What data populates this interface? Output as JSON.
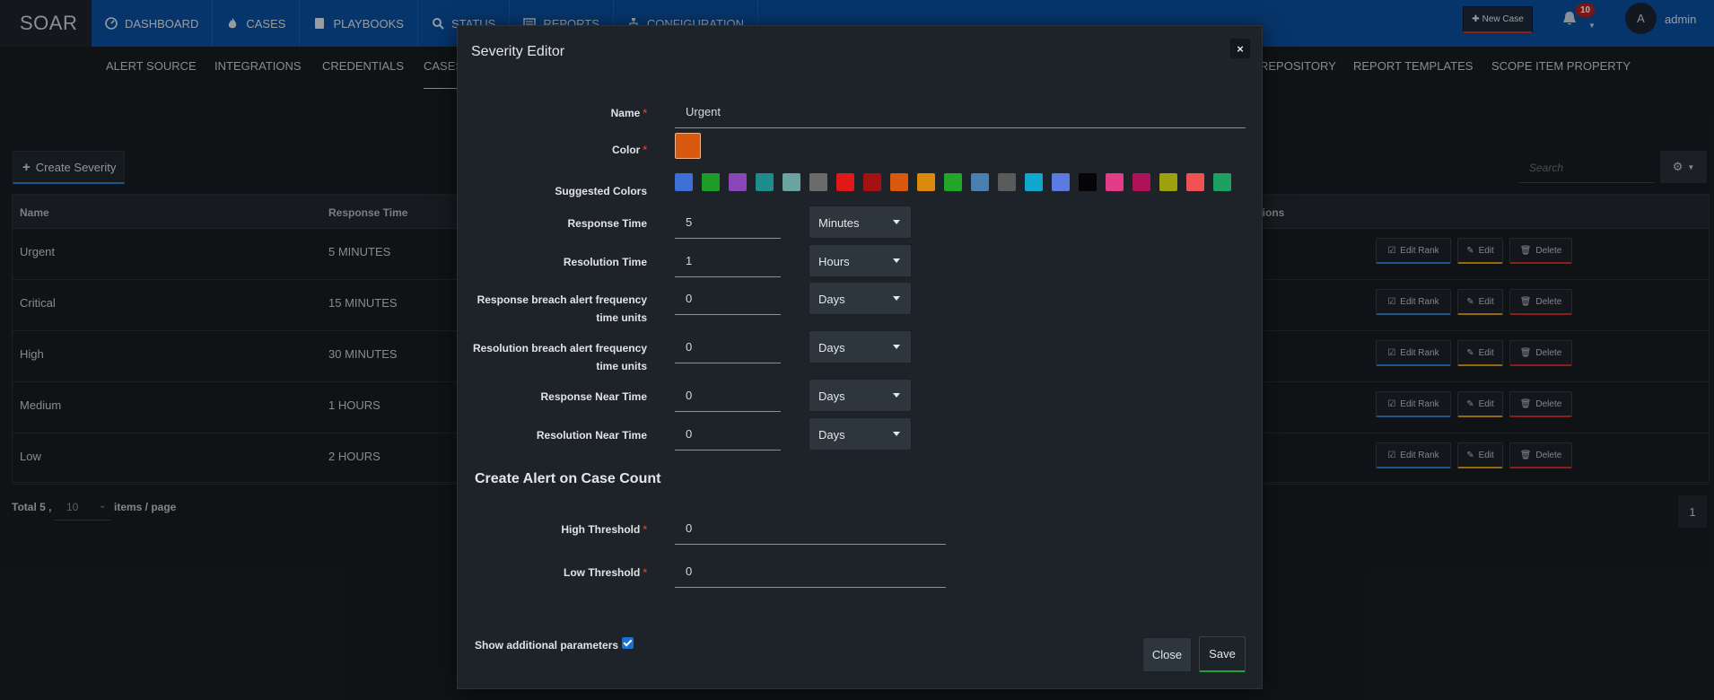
{
  "app": {
    "brand": "SOAR"
  },
  "nav": [
    {
      "label": "DASHBOARD",
      "icon": "dashboard-icon"
    },
    {
      "label": "CASES",
      "icon": "fire-icon"
    },
    {
      "label": "PLAYBOOKS",
      "icon": "book-icon"
    },
    {
      "label": "STATUS",
      "icon": "search-icon"
    },
    {
      "label": "REPORTS",
      "icon": "report-icon"
    },
    {
      "label": "CONFIGURATION",
      "icon": "sitemap-icon"
    }
  ],
  "header": {
    "new_case": "New Case",
    "notifications": "10",
    "avatar_letter": "A",
    "username": "admin"
  },
  "subnav": {
    "items": [
      "ALERT SOURCE",
      "INTEGRATIONS",
      "CREDENTIALS",
      "CASES",
      "REPOSITORY",
      "REPORT TEMPLATES",
      "SCOPE ITEM PROPERTY"
    ]
  },
  "page": {
    "create_button": "Create Severity",
    "search_placeholder": "Search",
    "columns": {
      "name": "Name",
      "response_time": "Response Time",
      "actions": "ctions"
    },
    "rows": [
      {
        "name": "Urgent",
        "response_time": "5 MINUTES"
      },
      {
        "name": "Critical",
        "response_time": "15 MINUTES"
      },
      {
        "name": "High",
        "response_time": "30 MINUTES"
      },
      {
        "name": "Medium",
        "response_time": "1 HOURS"
      },
      {
        "name": "Low",
        "response_time": "2 HOURS"
      }
    ],
    "actions": {
      "edit_rank": "Edit Rank",
      "edit": "Edit",
      "delete": "Delete"
    },
    "footer": {
      "total": "Total 5 ,",
      "per_page": "10",
      "items_label": "items / page",
      "page": "1"
    }
  },
  "modal": {
    "title": "Severity Editor",
    "close_x": "×",
    "labels": {
      "name": "Name",
      "color": "Color",
      "suggested_colors": "Suggested Colors",
      "response_time": "Response Time",
      "resolution_time": "Resolution Time",
      "response_breach_1": "Response breach alert frequency",
      "response_breach_2": "time units",
      "resolution_breach_1": "Resolution breach alert frequency",
      "resolution_breach_2": "time units",
      "response_near": "Response Near Time",
      "resolution_near": "Resolution Near Time",
      "high_threshold": "High Threshold",
      "low_threshold": "Low Threshold",
      "required": "*"
    },
    "values": {
      "name": "Urgent",
      "response_time": "5",
      "response_unit": "Minutes",
      "resolution_time": "1",
      "resolution_unit": "Hours",
      "response_breach": "0",
      "response_breach_unit": "Days",
      "resolution_breach": "0",
      "resolution_breach_unit": "Days",
      "response_near": "0",
      "response_near_unit": "Days",
      "resolution_near": "0",
      "resolution_near_unit": "Days",
      "high_threshold": "0",
      "low_threshold": "0"
    },
    "selected_color": "#d75a10",
    "suggested_colors": [
      "#3d6fd6",
      "#1e9c2a",
      "#8a45b8",
      "#1e8c8c",
      "#6aa3a0",
      "#6b6b6b",
      "#e01818",
      "#a51212",
      "#d9590f",
      "#d98a0a",
      "#22a62a",
      "#4a7fb0",
      "#5a5a5a",
      "#11a8d0",
      "#5c7be0",
      "#050505",
      "#e33d8a",
      "#b0125a",
      "#9fa00e",
      "#ee5252",
      "#1ea062"
    ],
    "section_title": "Create Alert on Case Count",
    "show_additional": "Show additional parameters",
    "close_button": "Close",
    "save_button": "Save"
  }
}
